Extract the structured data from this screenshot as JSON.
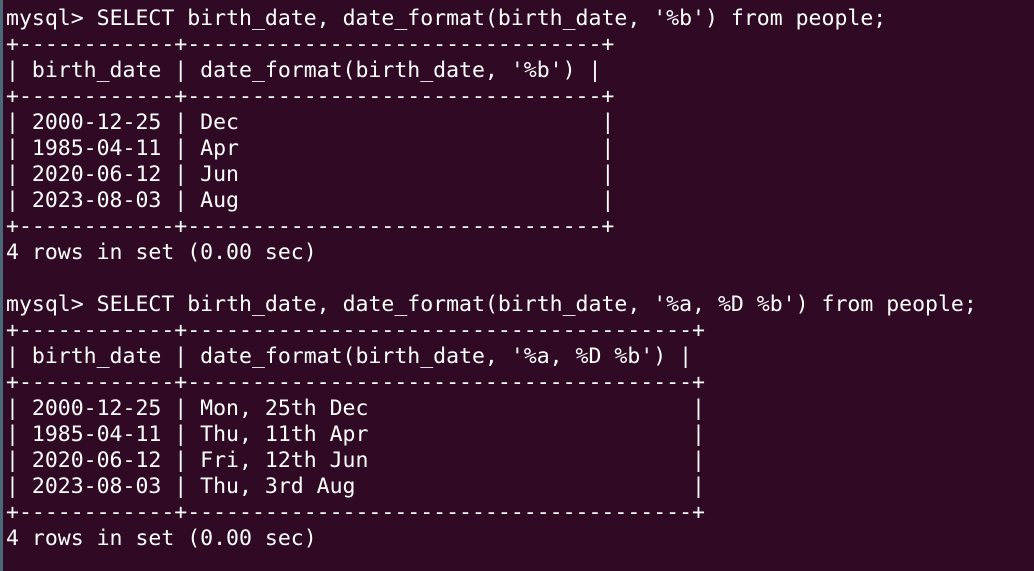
{
  "session": [
    {
      "prompt": "mysql>",
      "command": "SELECT birth_date, date_format(birth_date, '%b') from people;",
      "border": "+------------+--------------------------------+",
      "header": "| birth_date | date_format(birth_date, '%b') |",
      "rows": [
        "| 2000-12-25 | Dec                            |",
        "| 1985-04-11 | Apr                            |",
        "| 2020-06-12 | Jun                            |",
        "| 2023-08-03 | Aug                            |"
      ],
      "status": "4 rows in set (0.00 sec)"
    },
    {
      "prompt": "mysql>",
      "command": "SELECT birth_date, date_format(birth_date, '%a, %D %b') from people;",
      "border": "+------------+---------------------------------------+",
      "header": "| birth_date | date_format(birth_date, '%a, %D %b') |",
      "rows": [
        "| 2000-12-25 | Mon, 25th Dec                         |",
        "| 1985-04-11 | Thu, 11th Apr                         |",
        "| 2020-06-12 | Fri, 12th Jun                         |",
        "| 2023-08-03 | Thu, 3rd Aug                          |"
      ],
      "status": "4 rows in set (0.00 sec)"
    }
  ]
}
